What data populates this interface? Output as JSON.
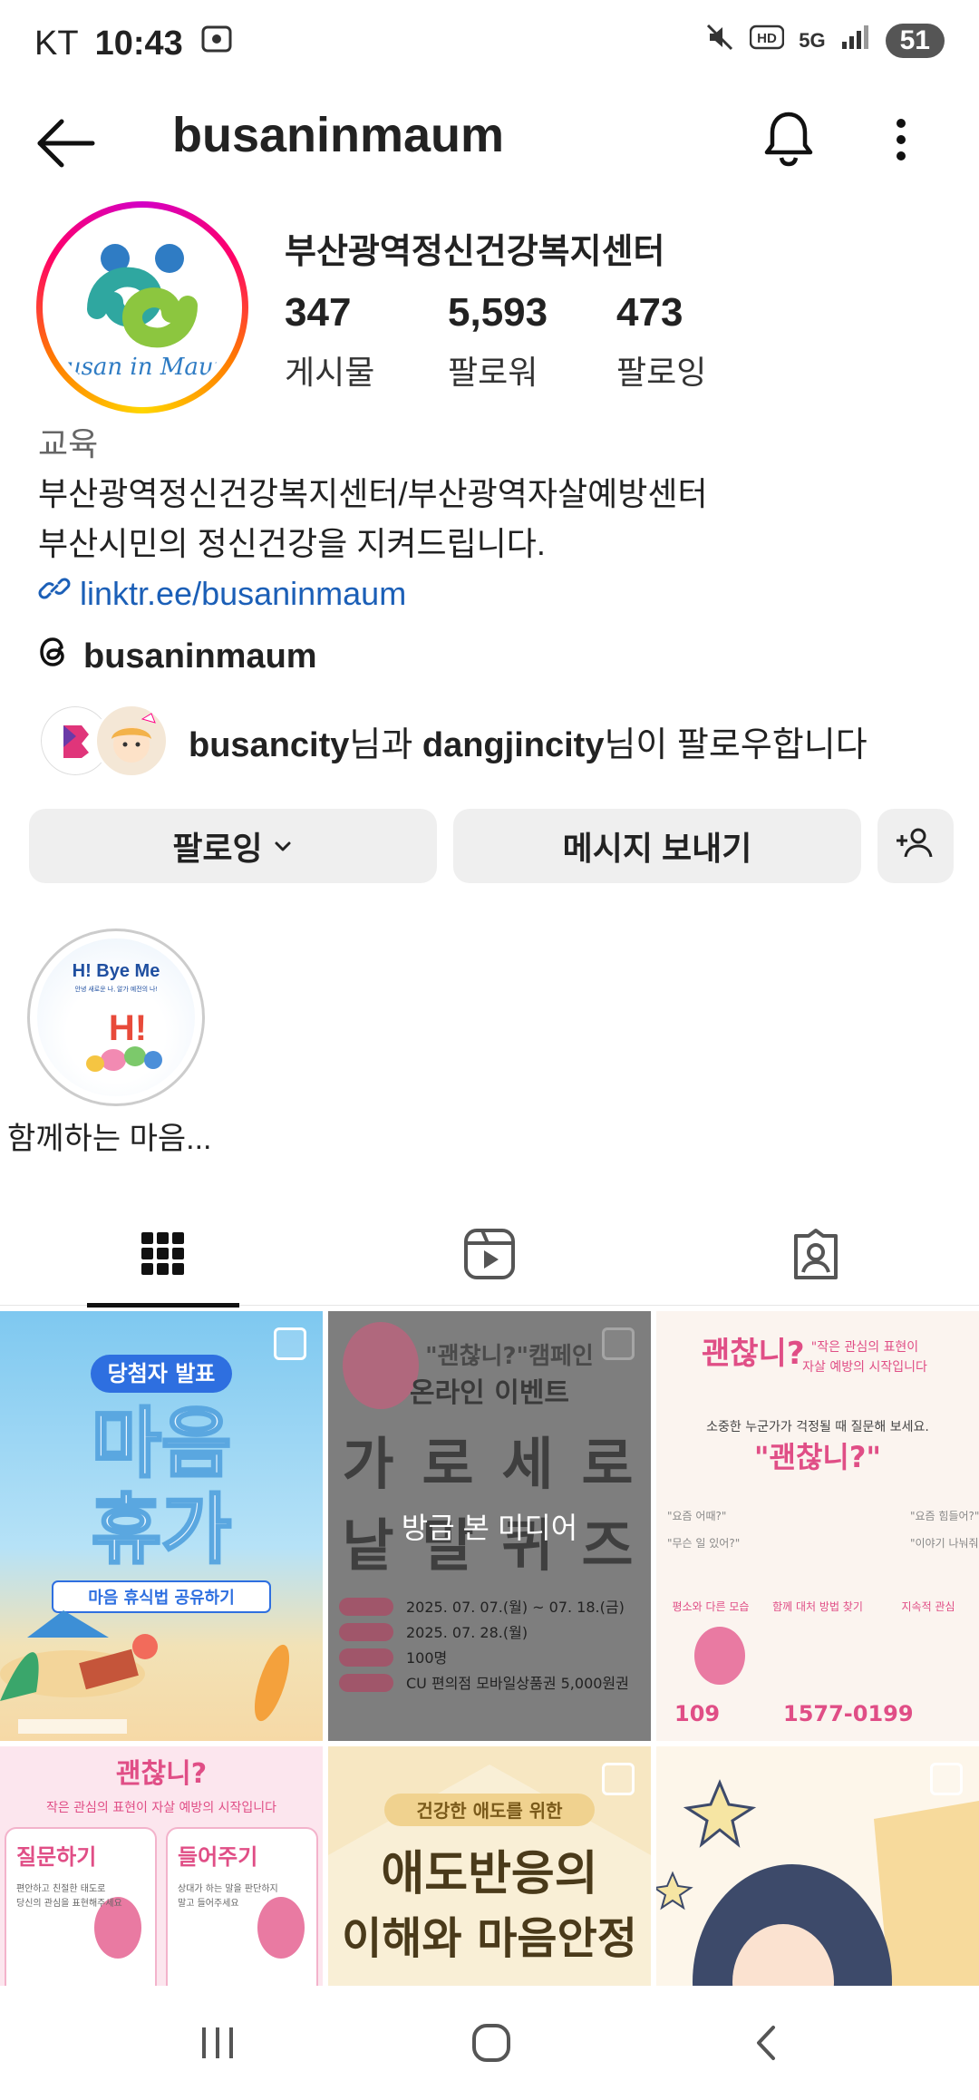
{
  "status_bar": {
    "carrier": "KT",
    "time": "10:43",
    "battery": "51",
    "network": "5G"
  },
  "header": {
    "username": "busaninmaum"
  },
  "profile": {
    "display_name": "부산광역정신건강복지센터",
    "avatar_text": "Busan in Maum",
    "stats": [
      {
        "value": "347",
        "label": "게시물"
      },
      {
        "value": "5,593",
        "label": "팔로워"
      },
      {
        "value": "473",
        "label": "팔로잉"
      }
    ],
    "category": "교육",
    "bio_lines": [
      "부산광역정신건강복지센터/부산광역자살예방센터",
      "부산시민의 정신건강을 지켜드립니다."
    ],
    "link": "linktr.ee/busaninmaum",
    "threads_handle": "busaninmaum",
    "mutual": {
      "user1": "busancity",
      "mid": "님과 ",
      "user2": "dangjincity",
      "tail": "님이 팔로우합니다"
    }
  },
  "buttons": {
    "follow": "팔로잉",
    "message": "메시지 보내기"
  },
  "highlight": {
    "label": "함께하는 마음...",
    "cover_title": "H! Bye Me",
    "cover_sub": "안녕 새로운 나, 알가 예전의 나!"
  },
  "posts": [
    {
      "headline": "당첨자 발표",
      "big": "마음\n휴가",
      "sub": "마음 휴식법 공유하기"
    },
    {
      "headline": "\"괜찮니?\"캠페인 온라인 이벤트",
      "big": "가로세로 낱말퀴즈",
      "overlay": "방금 본 미디어",
      "dates": "2025. 07. 07.(월) ~ 07. 18.(금)",
      "draw": "2025. 07. 28.(월)",
      "count": "100명",
      "prize": "CU 편의점 모바일상품권 5,000원권"
    },
    {
      "headline": "괜찮니?",
      "sub": "작은 관심의 표현이 자살 예방의 시작입니다",
      "phone1": "109",
      "phone2": "1577-0199"
    },
    {
      "headline": "괜찮니?",
      "sub": "작은 관심의 표현이 자살 예방의 시작입니다",
      "left": "질문하기",
      "right": "들어주기"
    },
    {
      "headline": "건강한 애도를 위한",
      "big1": "애도반응의",
      "big2": "이해와 마음안정"
    },
    {
      "headline": ""
    }
  ]
}
